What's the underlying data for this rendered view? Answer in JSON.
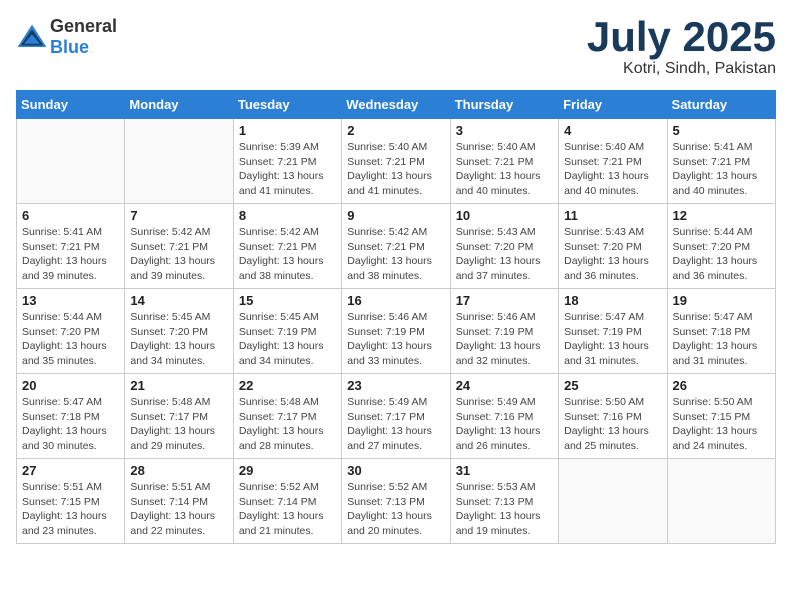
{
  "header": {
    "logo_general": "General",
    "logo_blue": "Blue",
    "month_year": "July 2025",
    "location": "Kotri, Sindh, Pakistan"
  },
  "days_of_week": [
    "Sunday",
    "Monday",
    "Tuesday",
    "Wednesday",
    "Thursday",
    "Friday",
    "Saturday"
  ],
  "weeks": [
    [
      {
        "day": "",
        "detail": ""
      },
      {
        "day": "",
        "detail": ""
      },
      {
        "day": "1",
        "detail": "Sunrise: 5:39 AM\nSunset: 7:21 PM\nDaylight: 13 hours and 41 minutes."
      },
      {
        "day": "2",
        "detail": "Sunrise: 5:40 AM\nSunset: 7:21 PM\nDaylight: 13 hours and 41 minutes."
      },
      {
        "day": "3",
        "detail": "Sunrise: 5:40 AM\nSunset: 7:21 PM\nDaylight: 13 hours and 40 minutes."
      },
      {
        "day": "4",
        "detail": "Sunrise: 5:40 AM\nSunset: 7:21 PM\nDaylight: 13 hours and 40 minutes."
      },
      {
        "day": "5",
        "detail": "Sunrise: 5:41 AM\nSunset: 7:21 PM\nDaylight: 13 hours and 40 minutes."
      }
    ],
    [
      {
        "day": "6",
        "detail": "Sunrise: 5:41 AM\nSunset: 7:21 PM\nDaylight: 13 hours and 39 minutes."
      },
      {
        "day": "7",
        "detail": "Sunrise: 5:42 AM\nSunset: 7:21 PM\nDaylight: 13 hours and 39 minutes."
      },
      {
        "day": "8",
        "detail": "Sunrise: 5:42 AM\nSunset: 7:21 PM\nDaylight: 13 hours and 38 minutes."
      },
      {
        "day": "9",
        "detail": "Sunrise: 5:42 AM\nSunset: 7:21 PM\nDaylight: 13 hours and 38 minutes."
      },
      {
        "day": "10",
        "detail": "Sunrise: 5:43 AM\nSunset: 7:20 PM\nDaylight: 13 hours and 37 minutes."
      },
      {
        "day": "11",
        "detail": "Sunrise: 5:43 AM\nSunset: 7:20 PM\nDaylight: 13 hours and 36 minutes."
      },
      {
        "day": "12",
        "detail": "Sunrise: 5:44 AM\nSunset: 7:20 PM\nDaylight: 13 hours and 36 minutes."
      }
    ],
    [
      {
        "day": "13",
        "detail": "Sunrise: 5:44 AM\nSunset: 7:20 PM\nDaylight: 13 hours and 35 minutes."
      },
      {
        "day": "14",
        "detail": "Sunrise: 5:45 AM\nSunset: 7:20 PM\nDaylight: 13 hours and 34 minutes."
      },
      {
        "day": "15",
        "detail": "Sunrise: 5:45 AM\nSunset: 7:19 PM\nDaylight: 13 hours and 34 minutes."
      },
      {
        "day": "16",
        "detail": "Sunrise: 5:46 AM\nSunset: 7:19 PM\nDaylight: 13 hours and 33 minutes."
      },
      {
        "day": "17",
        "detail": "Sunrise: 5:46 AM\nSunset: 7:19 PM\nDaylight: 13 hours and 32 minutes."
      },
      {
        "day": "18",
        "detail": "Sunrise: 5:47 AM\nSunset: 7:19 PM\nDaylight: 13 hours and 31 minutes."
      },
      {
        "day": "19",
        "detail": "Sunrise: 5:47 AM\nSunset: 7:18 PM\nDaylight: 13 hours and 31 minutes."
      }
    ],
    [
      {
        "day": "20",
        "detail": "Sunrise: 5:47 AM\nSunset: 7:18 PM\nDaylight: 13 hours and 30 minutes."
      },
      {
        "day": "21",
        "detail": "Sunrise: 5:48 AM\nSunset: 7:17 PM\nDaylight: 13 hours and 29 minutes."
      },
      {
        "day": "22",
        "detail": "Sunrise: 5:48 AM\nSunset: 7:17 PM\nDaylight: 13 hours and 28 minutes."
      },
      {
        "day": "23",
        "detail": "Sunrise: 5:49 AM\nSunset: 7:17 PM\nDaylight: 13 hours and 27 minutes."
      },
      {
        "day": "24",
        "detail": "Sunrise: 5:49 AM\nSunset: 7:16 PM\nDaylight: 13 hours and 26 minutes."
      },
      {
        "day": "25",
        "detail": "Sunrise: 5:50 AM\nSunset: 7:16 PM\nDaylight: 13 hours and 25 minutes."
      },
      {
        "day": "26",
        "detail": "Sunrise: 5:50 AM\nSunset: 7:15 PM\nDaylight: 13 hours and 24 minutes."
      }
    ],
    [
      {
        "day": "27",
        "detail": "Sunrise: 5:51 AM\nSunset: 7:15 PM\nDaylight: 13 hours and 23 minutes."
      },
      {
        "day": "28",
        "detail": "Sunrise: 5:51 AM\nSunset: 7:14 PM\nDaylight: 13 hours and 22 minutes."
      },
      {
        "day": "29",
        "detail": "Sunrise: 5:52 AM\nSunset: 7:14 PM\nDaylight: 13 hours and 21 minutes."
      },
      {
        "day": "30",
        "detail": "Sunrise: 5:52 AM\nSunset: 7:13 PM\nDaylight: 13 hours and 20 minutes."
      },
      {
        "day": "31",
        "detail": "Sunrise: 5:53 AM\nSunset: 7:13 PM\nDaylight: 13 hours and 19 minutes."
      },
      {
        "day": "",
        "detail": ""
      },
      {
        "day": "",
        "detail": ""
      }
    ]
  ]
}
